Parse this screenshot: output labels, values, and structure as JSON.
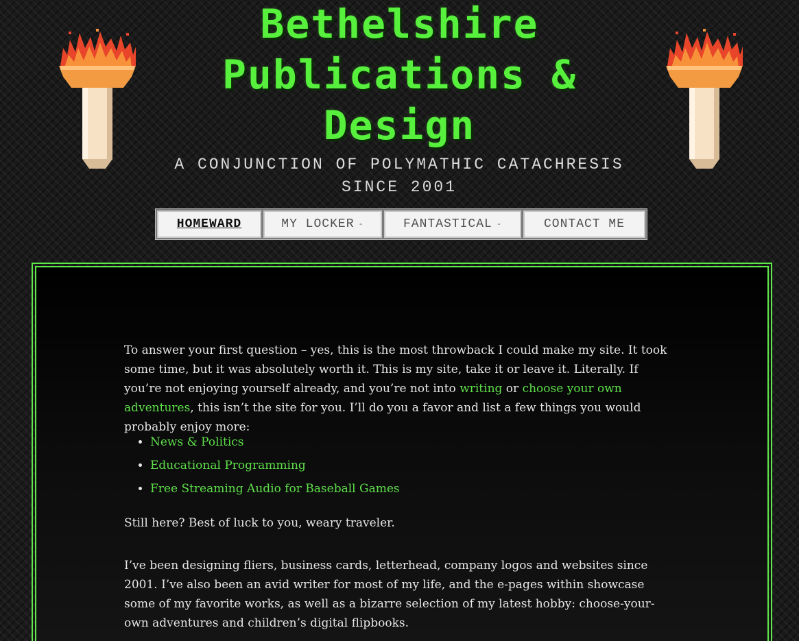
{
  "header": {
    "title_line1": "Bethelshire",
    "title_line2": "Publications &",
    "title_line3": "Design",
    "tagline_line1": "A CONJUNCTION OF POLYMATHIC CATACHRESIS",
    "tagline_line2": "SINCE 2001",
    "left_icon": "torch-icon",
    "right_icon": "torch-icon"
  },
  "nav": {
    "items": [
      {
        "label": "HOMEWARD",
        "active": true,
        "dropdown": false
      },
      {
        "label": "MY LOCKER",
        "active": false,
        "dropdown": true
      },
      {
        "label": "FANTASTICAL",
        "active": false,
        "dropdown": true
      },
      {
        "label": "CONTACT ME",
        "active": false,
        "dropdown": false
      }
    ],
    "caret": "-"
  },
  "content": {
    "p1": {
      "before": "To answer your first question – yes, this is the most throwback I could make my site. It took some time, but it was absolutely worth it. This is my site, take it or leave it. Literally. If you’re not enjoying yourself already, and you’re not into ",
      "link1": "writing",
      "between": " or ",
      "link2": "choose your own adventures",
      "after": ", this isn’t the site for you. I’ll do you a favor and list a few things you would probably enjoy more:"
    },
    "list": [
      "News & Politics",
      "Educational Programming",
      "Free Streaming Audio for Baseball Games"
    ],
    "p3": "Still here? Best of luck to you, weary traveler.",
    "p4": "I’ve been designing fliers, business cards, letterhead, company logos and websites since 2001. I’ve also been an avid writer for most of my life, and the e-pages within showcase some of my favorite works, as well as a bizarre selection of my latest hobby: choose-your-own adventures and children’s digital flipbooks."
  },
  "colors": {
    "accent_green": "#57f03d",
    "link_green": "#5ee04a",
    "frame_green": "#5fe84a",
    "text": "#e6e6e6"
  }
}
